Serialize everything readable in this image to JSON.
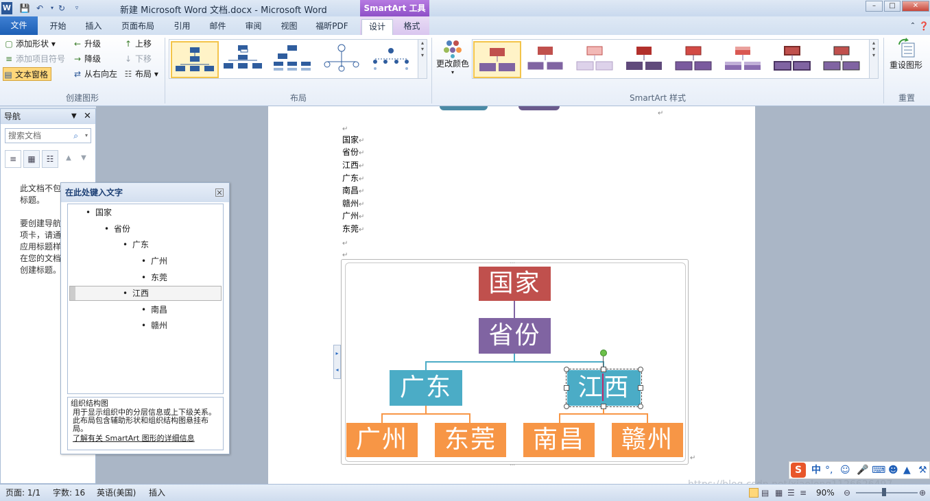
{
  "titlebar": {
    "doc_title": "新建 Microsoft Word 文档.docx - Microsoft Word",
    "contextual_tools": "SmartArt 工具",
    "app_icon": "W"
  },
  "tabs": {
    "file": "文件",
    "items": [
      "开始",
      "插入",
      "页面布局",
      "引用",
      "邮件",
      "审阅",
      "视图",
      "福昕PDF",
      "设计",
      "格式"
    ]
  },
  "ribbon": {
    "create_group": {
      "label": "创建图形",
      "add_shape": "添加形状",
      "add_bullet": "添加项目符号",
      "text_pane": "文本窗格",
      "promote": "升级",
      "demote": "降级",
      "right_to_left": "从右向左",
      "move_up": "上移",
      "move_down": "下移",
      "layout": "布局"
    },
    "layout_group": {
      "label": "布局"
    },
    "styles_group": {
      "label": "SmartArt 样式",
      "change_colors": "更改颜色"
    },
    "reset_group": {
      "label": "重置",
      "reset_graphic": "重设图形"
    }
  },
  "navigation": {
    "title": "导航",
    "search_placeholder": "搜索文档",
    "message_lines": [
      "此文档不包",
      "标题。",
      "",
      "要创建导航",
      "项卡，请通",
      "应用标题样",
      "在您的文档",
      "创建标题。"
    ]
  },
  "document": {
    "lines": [
      "国家",
      "省份",
      "江西",
      "广东",
      "南昌",
      "赣州",
      "广州",
      "东莞"
    ]
  },
  "smartart": {
    "root": "国家",
    "level2": "省份",
    "level3": [
      "广东",
      "江西"
    ],
    "level4": [
      "广州",
      "东莞",
      "南昌",
      "赣州"
    ]
  },
  "text_pane": {
    "title": "在此处键入文字",
    "items": [
      {
        "text": "国家",
        "level": 1
      },
      {
        "text": "省份",
        "level": 2
      },
      {
        "text": "广东",
        "level": 3
      },
      {
        "text": "广州",
        "level": 4
      },
      {
        "text": "东莞",
        "level": 4
      },
      {
        "text": "江西",
        "level": 3
      },
      {
        "text": "南昌",
        "level": 4
      },
      {
        "text": "赣州",
        "level": 4
      }
    ],
    "desc_title": "组织结构图",
    "desc_body": "用于显示组织中的分层信息或上下级关系。此布局包含辅助形状和组织结构图悬挂布局。",
    "desc_link": "了解有关 SmartArt 图形的详细信息"
  },
  "statusbar": {
    "page": "页面: 1/1",
    "words": "字数: 16",
    "language": "英语(美国)",
    "mode": "插入",
    "zoom": "90%"
  },
  "ime": {
    "label": "中"
  },
  "watermark": "https://blog.csdn.net/xiaolong1126626497",
  "colors": {
    "root": "#c0504d",
    "level2": "#8064a2",
    "level3": "#4bacc6",
    "level4": "#f79646",
    "ribbon_accent": "#9e5bd2"
  }
}
